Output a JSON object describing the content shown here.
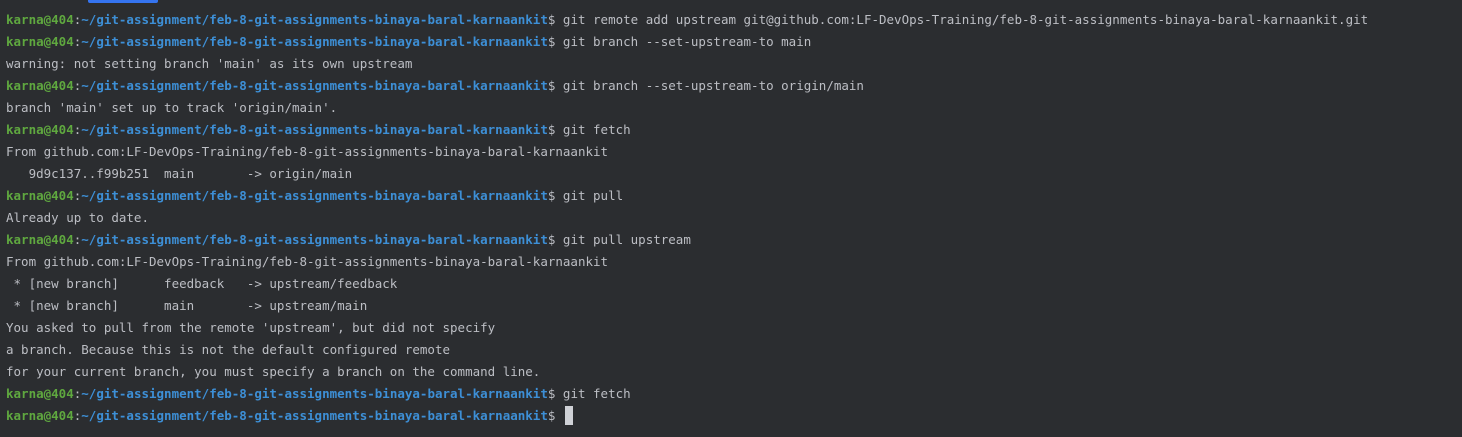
{
  "prompt": {
    "user": "karna@404",
    "colon": ":",
    "path": "~/git-assignment/feb-8-git-assignments-binaya-baral-karnaankit",
    "symbol": "$"
  },
  "lines": [
    {
      "type": "prompt",
      "command": " git remote add upstream git@github.com:LF-DevOps-Training/feb-8-git-assignments-binaya-baral-karnaankit.git"
    },
    {
      "type": "prompt",
      "command": " git branch --set-upstream-to main"
    },
    {
      "type": "output",
      "text": "warning: not setting branch 'main' as its own upstream"
    },
    {
      "type": "prompt",
      "command": " git branch --set-upstream-to origin/main"
    },
    {
      "type": "output",
      "text": "branch 'main' set up to track 'origin/main'."
    },
    {
      "type": "prompt",
      "command": " git fetch"
    },
    {
      "type": "output",
      "text": "From github.com:LF-DevOps-Training/feb-8-git-assignments-binaya-baral-karnaankit"
    },
    {
      "type": "output",
      "text": "   9d9c137..f99b251  main       -> origin/main"
    },
    {
      "type": "prompt",
      "command": " git pull"
    },
    {
      "type": "output",
      "text": "Already up to date."
    },
    {
      "type": "prompt",
      "command": " git pull upstream"
    },
    {
      "type": "output",
      "text": "From github.com:LF-DevOps-Training/feb-8-git-assignments-binaya-baral-karnaankit"
    },
    {
      "type": "output",
      "text": " * [new branch]      feedback   -> upstream/feedback"
    },
    {
      "type": "output",
      "text": " * [new branch]      main       -> upstream/main"
    },
    {
      "type": "output",
      "text": "You asked to pull from the remote 'upstream', but did not specify"
    },
    {
      "type": "output",
      "text": "a branch. Because this is not the default configured remote"
    },
    {
      "type": "output",
      "text": "for your current branch, you must specify a branch on the command line."
    },
    {
      "type": "prompt",
      "command": " git fetch"
    },
    {
      "type": "prompt",
      "command": " ",
      "cursor": true
    }
  ],
  "colors": {
    "background": "#2b2d30",
    "user": "#5fa83f",
    "path": "#3d8fd6",
    "text": "#bcbec4",
    "accent": "#3574f0"
  }
}
